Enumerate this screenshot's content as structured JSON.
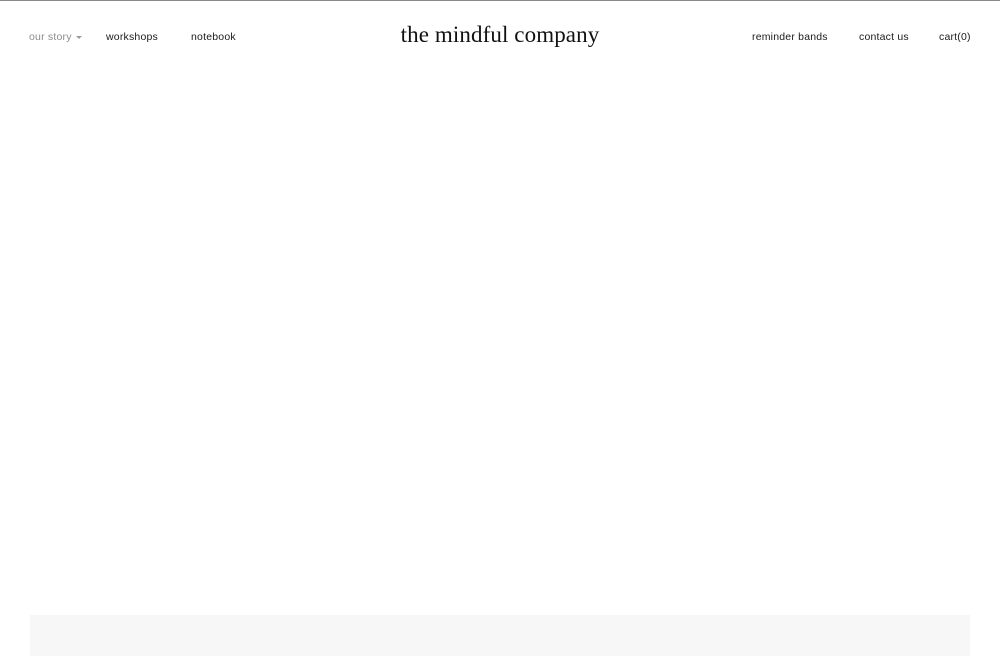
{
  "header": {
    "logo_text": "the mindful company",
    "nav_left": [
      {
        "label": "our story",
        "has_dropdown": true
      },
      {
        "label": "workshops"
      },
      {
        "label": "notebook"
      }
    ],
    "nav_right": [
      {
        "label": "reminder bands"
      },
      {
        "label": "contact us"
      }
    ],
    "cart": {
      "prefix": "cart(",
      "count": "0",
      "suffix": ")"
    }
  },
  "colors": {
    "text": "#1a1a1a",
    "muted_nav": "#8c8c8c",
    "footer_band": "#f7f7f7",
    "top_rule": "#8a8a8a"
  }
}
